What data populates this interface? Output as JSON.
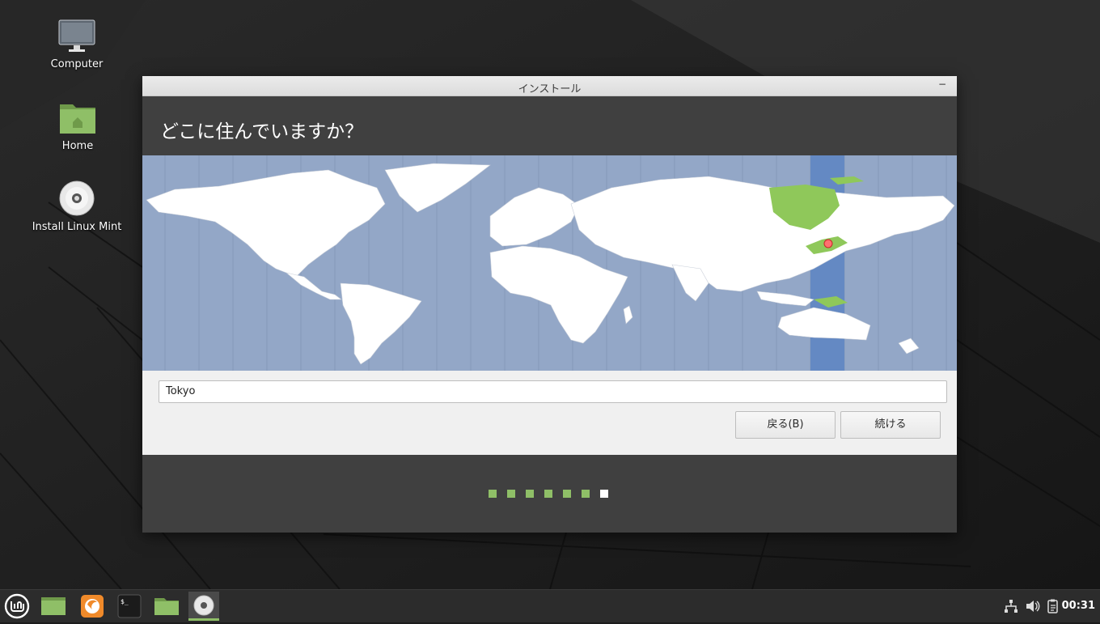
{
  "desktop": {
    "icons": [
      {
        "label": "Computer"
      },
      {
        "label": "Home"
      },
      {
        "label": "Install Linux Mint"
      }
    ]
  },
  "window": {
    "title": "インストール",
    "minimize_label": "−",
    "heading": "どこに住んでいますか？",
    "timezone_value": "Tokyo",
    "back_label": "戻る(B)",
    "continue_label": "続ける",
    "progress": {
      "total_steps": 7,
      "current_step": 7
    }
  },
  "taskbar": {
    "clock": "00:31"
  },
  "colors": {
    "mint_green": "#8fbf67",
    "map_ocean": "#93a7c7",
    "selected_zone": "#6489c3",
    "header_bg": "#404040"
  }
}
